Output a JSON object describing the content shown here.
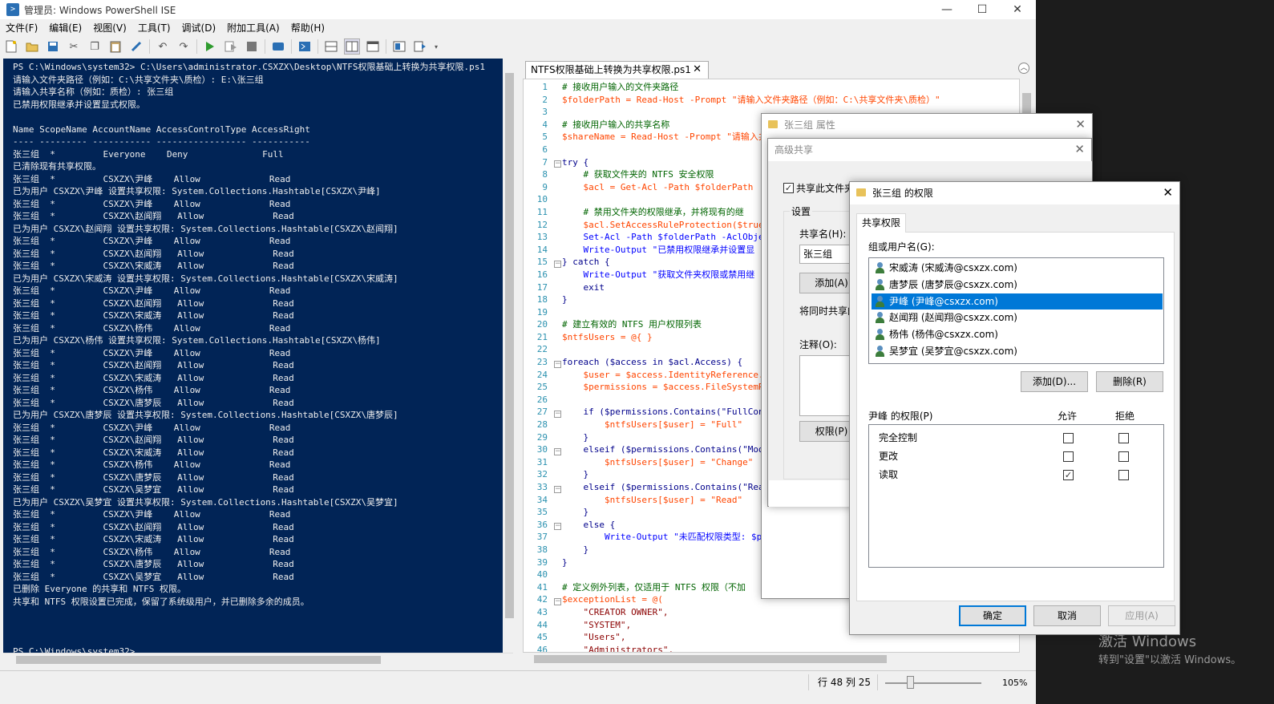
{
  "window": {
    "title": "管理员: Windows PowerShell ISE",
    "min": "—",
    "max": "☐",
    "close": "✕"
  },
  "menu": [
    "文件(F)",
    "编辑(E)",
    "视图(V)",
    "工具(T)",
    "调试(D)",
    "附加工具(A)",
    "帮助(H)"
  ],
  "console_lines": [
    "PS C:\\Windows\\system32> C:\\Users\\administrator.CSXZX\\Desktop\\NTFS权限基础上转换为共享权限.ps1",
    "请输入文件夹路径（例如：C:\\共享文件夹\\质检）: E:\\张三组",
    "请输入共享名称（例如：质检）: 张三组",
    "已禁用权限继承并设置显式权限。",
    "",
    "Name ScopeName AccountName AccessControlType AccessRight",
    "---- --------- ----------- ----------------- -----------",
    "张三组  *         Everyone    Deny              Full",
    "已清除现有共享权限。",
    "张三组  *         CSXZX\\尹峰    Allow             Read",
    "已为用户 CSXZX\\尹峰 设置共享权限: System.Collections.Hashtable[CSXZX\\尹峰]",
    "张三组  *         CSXZX\\尹峰    Allow             Read",
    "张三组  *         CSXZX\\赵闻翔   Allow             Read",
    "已为用户 CSXZX\\赵闻翔 设置共享权限: System.Collections.Hashtable[CSXZX\\赵闻翔]",
    "张三组  *         CSXZX\\尹峰    Allow             Read",
    "张三组  *         CSXZX\\赵闻翔   Allow             Read",
    "张三组  *         CSXZX\\宋威涛   Allow             Read",
    "已为用户 CSXZX\\宋威涛 设置共享权限: System.Collections.Hashtable[CSXZX\\宋威涛]",
    "张三组  *         CSXZX\\尹峰    Allow             Read",
    "张三组  *         CSXZX\\赵闻翔   Allow             Read",
    "张三组  *         CSXZX\\宋威涛   Allow             Read",
    "张三组  *         CSXZX\\杨伟    Allow             Read",
    "已为用户 CSXZX\\杨伟 设置共享权限: System.Collections.Hashtable[CSXZX\\杨伟]",
    "张三组  *         CSXZX\\尹峰    Allow             Read",
    "张三组  *         CSXZX\\赵闻翔   Allow             Read",
    "张三组  *         CSXZX\\宋威涛   Allow             Read",
    "张三组  *         CSXZX\\杨伟    Allow             Read",
    "张三组  *         CSXZX\\唐梦辰   Allow             Read",
    "已为用户 CSXZX\\唐梦辰 设置共享权限: System.Collections.Hashtable[CSXZX\\唐梦辰]",
    "张三组  *         CSXZX\\尹峰    Allow             Read",
    "张三组  *         CSXZX\\赵闻翔   Allow             Read",
    "张三组  *         CSXZX\\宋威涛   Allow             Read",
    "张三组  *         CSXZX\\杨伟    Allow             Read",
    "张三组  *         CSXZX\\唐梦辰   Allow             Read",
    "张三组  *         CSXZX\\吴梦宜   Allow             Read",
    "已为用户 CSXZX\\吴梦宜 设置共享权限: System.Collections.Hashtable[CSXZX\\吴梦宜]",
    "张三组  *         CSXZX\\尹峰    Allow             Read",
    "张三组  *         CSXZX\\赵闻翔   Allow             Read",
    "张三组  *         CSXZX\\宋威涛   Allow             Read",
    "张三组  *         CSXZX\\杨伟    Allow             Read",
    "张三组  *         CSXZX\\唐梦辰   Allow             Read",
    "张三组  *         CSXZX\\吴梦宜   Allow             Read",
    "已删除 Everyone 的共享和 NTFS 权限。",
    "共享和 NTFS 权限设置已完成，保留了系统级用户，并已删除多余的成员。",
    "",
    "",
    "",
    "PS C:\\Windows\\system32>"
  ],
  "editor": {
    "tab_label": "NTFS权限基础上转换为共享权限.ps1",
    "tab_close": "✕",
    "line_numbers": [
      "1",
      "2",
      "3",
      "4",
      "5",
      "6",
      "7",
      "8",
      "9",
      "10",
      "11",
      "12",
      "13",
      "14",
      "15",
      "16",
      "17",
      "18",
      "19",
      "20",
      "21",
      "22",
      "23",
      "24",
      "25",
      "26",
      "27",
      "28",
      "29",
      "30",
      "31",
      "32",
      "33",
      "34",
      "35",
      "36",
      "37",
      "38",
      "39",
      "40",
      "41",
      "42",
      "43",
      "44",
      "45",
      "46"
    ],
    "code_lines": [
      "# 接收用户输入的文件夹路径",
      "$folderPath = Read-Host -Prompt \"请输入文件夹路径（例如：C:\\共享文件夹\\质检）\"",
      "",
      "# 接收用户输入的共享名称",
      "$shareName = Read-Host -Prompt \"请输入共",
      "",
      "try {",
      "    # 获取文件夹的 NTFS 安全权限",
      "    $acl = Get-Acl -Path $folderPath",
      "",
      "    # 禁用文件夹的权限继承，并将现有的继",
      "    $acl.SetAccessRuleProtection($true,",
      "    Set-Acl -Path $folderPath -AclObject",
      "    Write-Output \"已禁用权限继承并设置显",
      "} catch {",
      "    Write-Output \"获取文件夹权限或禁用继",
      "    exit",
      "}",
      "",
      "# 建立有效的 NTFS 用户权限列表",
      "$ntfsUsers = @{ }",
      "",
      "foreach ($access in $acl.Access) {",
      "    $user = $access.IdentityReference.Va",
      "    $permissions = $access.FileSystemRig",
      "",
      "    if ($permissions.Contains(\"FullContr",
      "        $ntfsUsers[$user] = \"Full\"",
      "    }",
      "    elseif ($permissions.Contains(\"Modif",
      "        $ntfsUsers[$user] = \"Change\"",
      "    }",
      "    elseif ($permissions.Contains(\"ReadA",
      "        $ntfsUsers[$user] = \"Read\"",
      "    }",
      "    else {",
      "        Write-Output \"未匹配权限类型: $p",
      "    }",
      "}",
      "",
      "# 定义例外列表，仅适用于 NTFS 权限（不加",
      "$exceptionList = @(",
      "    \"CREATOR OWNER\",",
      "    \"SYSTEM\",",
      "    \"Users\",",
      "    \"Administrators\","
    ]
  },
  "status": {
    "position": "行 48 列 25",
    "zoom": "105%"
  },
  "watermark": {
    "line1": "激活 Windows",
    "line2": "转到\"设置\"以激活 Windows。"
  },
  "dlg_props": {
    "title": "张三组 属性",
    "close": "✕"
  },
  "dlg_adv": {
    "title": "高级共享",
    "close": "✕",
    "share_checkbox": "共享此文件夹",
    "settings_label": "设置",
    "share_name_label": "共享名(H):",
    "share_name_value": "张三组",
    "add_button": "添加(A)",
    "concurrent_label": "将同时共享的",
    "comment_label": "注释(O):",
    "permissions_button": "权限(P)"
  },
  "dlg_perm": {
    "title": "张三组 的权限",
    "close": "✕",
    "tab": "共享权限",
    "group_label": "组或用户名(G):",
    "users": [
      "宋威涛 (宋威涛@csxzx.com)",
      "唐梦辰 (唐梦辰@csxzx.com)",
      "尹峰 (尹峰@csxzx.com)",
      "赵闻翔 (赵闻翔@csxzx.com)",
      "杨伟 (杨伟@csxzx.com)",
      "吴梦宜 (吴梦宜@csxzx.com)"
    ],
    "selected_index": 2,
    "add_button": "添加(D)...",
    "remove_button": "删除(R)",
    "perm_label": "尹峰 的权限(P)",
    "allow_header": "允许",
    "deny_header": "拒绝",
    "permissions": [
      {
        "name": "完全控制",
        "allow": false,
        "deny": false
      },
      {
        "name": "更改",
        "allow": false,
        "deny": false
      },
      {
        "name": "读取",
        "allow": true,
        "deny": false
      }
    ],
    "ok": "确定",
    "cancel": "取消",
    "apply": "应用(A)"
  }
}
